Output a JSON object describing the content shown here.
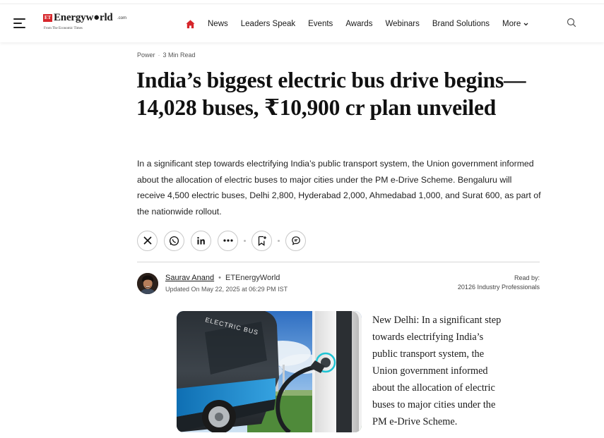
{
  "brand": {
    "et_badge": "ET",
    "name_part1": "Energyw",
    "name_part2": "rld",
    "domain": ".com",
    "tagline": "From The Economic Times",
    "accent_color": "#d6262b"
  },
  "nav": {
    "items": [
      "News",
      "Leaders Speak",
      "Events",
      "Awards",
      "Webinars",
      "Brand Solutions"
    ],
    "more_label": "More",
    "home_icon": "home-icon",
    "search_icon": "search-icon"
  },
  "article": {
    "category": "Power",
    "read_time": "3 Min Read",
    "title": "India’s biggest electric bus drive begins—14,028 buses, ₹10,900 cr plan unveiled",
    "summary": " In a significant step towards electrifying India’s public transport system, the Union government informed about the allocation of electric buses to major cities under the PM e-Drive Scheme. Bengaluru will receive 4,500 electric buses, Delhi 2,800, Hyderabad 2,000, Ahmedabad 1,000, and Surat 600, as part of the nationwide rollout.",
    "author": "Saurav Anand",
    "publication": "ETEnergyWorld",
    "updated": "Updated On May 22, 2025 at 06:29 PM IST",
    "read_by_label": "Read by:",
    "read_by_count": "20126 Industry Professionals",
    "image_caption_text": "ELECTRIC BUS",
    "body_dateline": "New Delhi:",
    "body_text": " In a significant step towards electrifying India’s public transport system, the Union government informed about the allocation of electric buses to major cities under the PM e-Drive Scheme."
  },
  "share": {
    "buttons": [
      "x-icon",
      "whatsapp-icon",
      "linkedin-icon",
      "more-icon",
      "bookmark-icon",
      "comment-icon"
    ]
  }
}
